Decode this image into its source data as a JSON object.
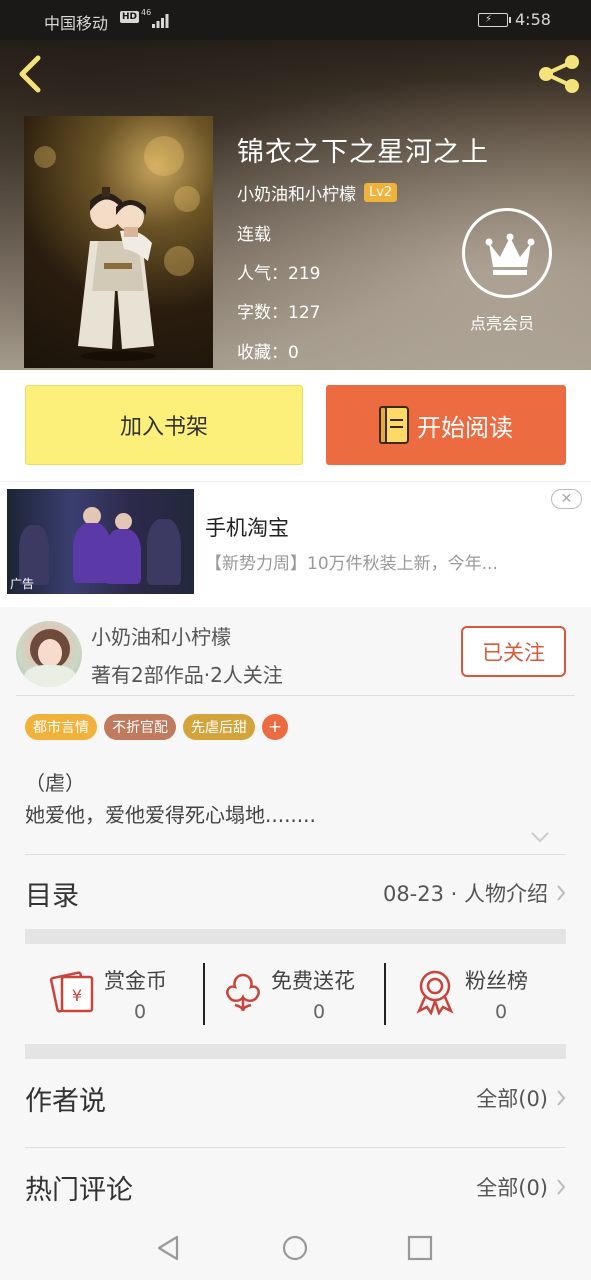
{
  "status_bar": {
    "carrier": "中国移动",
    "hd": "HD",
    "network": "46",
    "time": "4:58"
  },
  "book": {
    "title": "锦衣之下之星河之上",
    "author": "小奶油和小柠檬",
    "author_level": "Lv2",
    "status": "连载",
    "popularity_label": "人气：",
    "popularity": "219",
    "word_count_label": "字数：",
    "word_count": "127",
    "favorites_label": "收藏：",
    "favorites": "0"
  },
  "vip": {
    "label": "点亮会员"
  },
  "actions": {
    "add_shelf": "加入书架",
    "start_reading": "开始阅读"
  },
  "ad": {
    "title": "手机淘宝",
    "description": "【新势力周】10万件秋装上新，今年...",
    "tag": "广告",
    "close": "✕"
  },
  "author_card": {
    "name": "小奶油和小柠檬",
    "stats": "著有2部作品·2人关注",
    "follow_label": "已关注"
  },
  "tags": [
    {
      "label": "都市言情",
      "color": "#f0b23a"
    },
    {
      "label": "不折官配",
      "color": "#c07a5e"
    },
    {
      "label": "先虐后甜",
      "color": "#d4a43c"
    }
  ],
  "tag_add": "+",
  "intro": {
    "line1": "（虐）",
    "line2": "她爱他，爱他爱得死心塌地........"
  },
  "catalog": {
    "label": "目录",
    "latest": "08-23 · 人物介绍"
  },
  "stats": [
    {
      "label": "赏金币",
      "value": "0",
      "icon": "coin-envelope-icon"
    },
    {
      "label": "免费送花",
      "value": "0",
      "icon": "flower-icon"
    },
    {
      "label": "粉丝榜",
      "value": "0",
      "icon": "ribbon-medal-icon"
    }
  ],
  "author_says": {
    "label": "作者说",
    "all": "全部(0)"
  },
  "hot_comments": {
    "label": "热门评论",
    "all": "全部(0)"
  },
  "colors": {
    "accent_orange": "#ec6b40",
    "shelf_yellow": "#fcf07a",
    "follow_red": "#d9583b",
    "icon_red": "#c9453b"
  }
}
